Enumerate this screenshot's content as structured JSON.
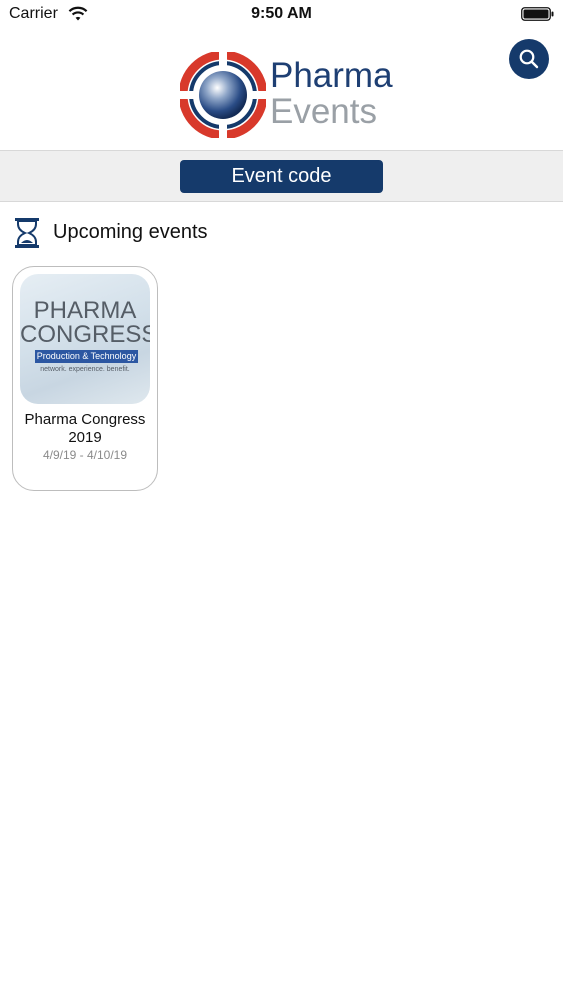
{
  "status_bar": {
    "carrier": "Carrier",
    "time": "9:50 AM",
    "wifi_icon": "wifi-icon",
    "battery_icon": "battery-full-icon"
  },
  "header": {
    "logo_word1": "Pharma",
    "logo_word2": "Events",
    "search_icon": "search-icon"
  },
  "colors": {
    "brand_navy": "#153a6b",
    "brand_red": "#d8392b",
    "logo_grey": "#9aa0a6"
  },
  "event_code_button": {
    "label": "Event code"
  },
  "upcoming": {
    "icon": "hourglass-icon",
    "title": "Upcoming events",
    "events": [
      {
        "thumb_line1": "PHARMA",
        "thumb_line2": "CONGRESS",
        "thumb_band": "Production & Technology",
        "thumb_tagline": "network. experience. benefit.",
        "name": "Pharma Congress 2019",
        "dates": "4/9/19 - 4/10/19"
      }
    ]
  }
}
